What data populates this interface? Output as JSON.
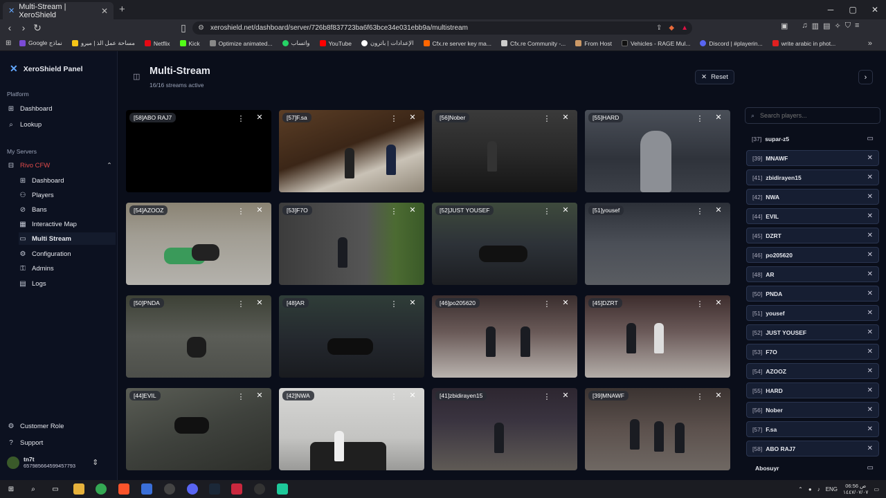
{
  "browser": {
    "tab_title": "Multi-Stream | XeroShield",
    "url": "xeroshield.net/dashboard/server/726b8f837723ba6f63bce34e031ebb9a/multistream",
    "bookmarks": [
      "Google نماذج",
      "مساحة عمل الذ | ميرو",
      "Netflix",
      "Kick",
      "Optimize animated...",
      "واتساب",
      "YouTube",
      "الإعدادات | باترون",
      "Cfx.re server key ma...",
      "Cfx.re Community -...",
      "From Host",
      "Vehicles - RAGE Mul...",
      "Discord | #playerin...",
      "write arabic in phot..."
    ]
  },
  "sidebar": {
    "brand": "XeroShield Panel",
    "section_platform": "Platform",
    "platform_items": [
      "Dashboard",
      "Lookup"
    ],
    "section_servers": "My Servers",
    "server_name": "Rivo CFW",
    "server_items": [
      "Dashboard",
      "Players",
      "Bans",
      "Interactive Map",
      "Multi Stream",
      "Configuration",
      "Admins",
      "Logs"
    ],
    "bottom_items": [
      "Customer Role",
      "Support"
    ],
    "user_name": "tn7t",
    "user_id": "657985664599457793"
  },
  "header": {
    "title": "Multi-Stream",
    "subtitle": "16/16 streams active",
    "reset_label": "Reset"
  },
  "streams": [
    "[58]ABO RAJ7",
    "[57]F.sa",
    "[56]Nober",
    "[55]HARD",
    "[54]AZOOZ",
    "[53]F7O",
    "[52]JUST YOUSEF",
    "[51]yousef",
    "[50]PNDA",
    "[48]AR",
    "[46]po205620",
    "[45]DZRT",
    "[44]EVIL",
    "[42]NWA",
    "[41]zbidirayen15",
    "[39]MNAWF"
  ],
  "panel": {
    "search_placeholder": "Search players...",
    "players": [
      {
        "num": "[37]",
        "name": "supar-z5",
        "on": false
      },
      {
        "num": "[39]",
        "name": "MNAWF",
        "on": true
      },
      {
        "num": "[41]",
        "name": "zbidirayen15",
        "on": true
      },
      {
        "num": "[42]",
        "name": "NWA",
        "on": true
      },
      {
        "num": "[44]",
        "name": "EVIL",
        "on": true
      },
      {
        "num": "[45]",
        "name": "DZRT",
        "on": true
      },
      {
        "num": "[46]",
        "name": "po205620",
        "on": true
      },
      {
        "num": "[48]",
        "name": "AR",
        "on": true
      },
      {
        "num": "[50]",
        "name": "PNDA",
        "on": true
      },
      {
        "num": "[51]",
        "name": "yousef",
        "on": true
      },
      {
        "num": "[52]",
        "name": "JUST YOUSEF",
        "on": true
      },
      {
        "num": "[53]",
        "name": "F7O",
        "on": true
      },
      {
        "num": "[54]",
        "name": "AZOOZ",
        "on": true
      },
      {
        "num": "[55]",
        "name": "HARD",
        "on": true
      },
      {
        "num": "[56]",
        "name": "Nober",
        "on": true
      },
      {
        "num": "[57]",
        "name": "F.sa",
        "on": true
      },
      {
        "num": "[58]",
        "name": "ABO RAJ7",
        "on": true
      },
      {
        "num": "",
        "name": "Abosuyr",
        "on": false
      }
    ]
  },
  "taskbar": {
    "lang": "ENG",
    "time": "06:56 ص",
    "date": "١٤٤٧/٠٧/٠٧"
  }
}
